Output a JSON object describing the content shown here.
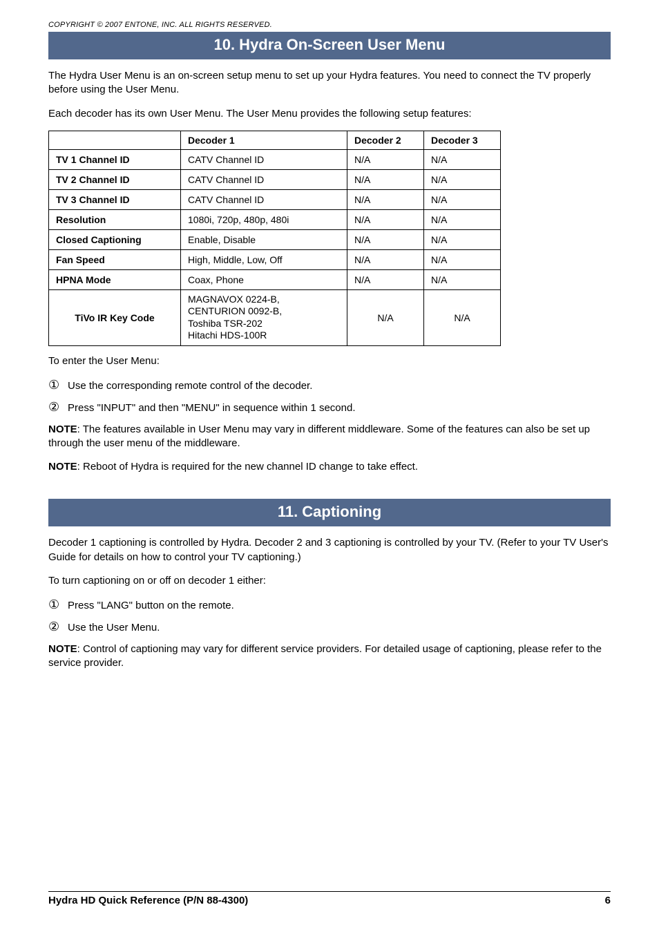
{
  "copyright": "COPYRIGHT © 2007 ENTONE, INC. ALL RIGHTS RESERVED.",
  "section10": {
    "title": "10. Hydra On-Screen User Menu",
    "intro1": "The Hydra User Menu is an on-screen setup menu to set up your Hydra features. You need to connect the TV properly before using the User Menu.",
    "intro2": "Each decoder has its own User Menu. The User Menu provides the following setup features:",
    "table": {
      "headers": {
        "blank": "",
        "d1": "Decoder 1",
        "d2": "Decoder 2",
        "d3": "Decoder 3"
      },
      "rows": [
        {
          "label": "TV 1 Channel ID",
          "d1": "CATV Channel ID",
          "d2": "N/A",
          "d3": "N/A"
        },
        {
          "label": "TV 2 Channel ID",
          "d1": "CATV Channel ID",
          "d2": "N/A",
          "d3": "N/A"
        },
        {
          "label": "TV 3 Channel ID",
          "d1": "CATV Channel ID",
          "d2": "N/A",
          "d3": "N/A"
        },
        {
          "label": "Resolution",
          "d1": "1080i, 720p, 480p, 480i",
          "d2": "N/A",
          "d3": "N/A"
        },
        {
          "label": "Closed Captioning",
          "d1": "Enable, Disable",
          "d2": "N/A",
          "d3": "N/A"
        },
        {
          "label": "Fan Speed",
          "d1": "High, Middle, Low, Off",
          "d2": "N/A",
          "d3": "N/A"
        },
        {
          "label": "HPNA Mode",
          "d1": "Coax, Phone",
          "d2": "N/A",
          "d3": "N/A"
        },
        {
          "label": "TiVo IR Key Code",
          "d1": "MAGNAVOX 0224-B,\nCENTURION 0092-B,\nToshiba TSR-202\nHitachi HDS-100R",
          "d2": "N/A",
          "d3": "N/A"
        }
      ]
    },
    "enter_intro": "To enter the User Menu:",
    "steps": {
      "s1_num": "①",
      "s1_text": "Use the corresponding remote control of the decoder.",
      "s2_num": "②",
      "s2_text": "Press \"INPUT\" and then \"MENU\" in sequence within 1 second."
    },
    "note1_label": "NOTE",
    "note1_text": ": The features available in User Menu may vary in different middleware. Some of the features can also be set up through the user menu of the middleware.",
    "note2_label": "NOTE",
    "note2_text": ": Reboot of Hydra is required for the new channel ID change to take effect."
  },
  "section11": {
    "title": "11. Captioning",
    "intro1": "Decoder 1 captioning is controlled by Hydra. Decoder 2 and 3 captioning is controlled by your TV. (Refer to your TV User's Guide for details on how to control your TV captioning.)",
    "intro2": "To turn captioning on or off on decoder 1 either:",
    "steps": {
      "s1_num": "①",
      "s1_text": "Press \"LANG\" button on the remote.",
      "s2_num": "②",
      "s2_text": "Use the User Menu."
    },
    "note_label": "NOTE",
    "note_text": ": Control of captioning may vary for different service providers. For detailed usage of captioning, please refer to the service provider."
  },
  "footer": {
    "left": "Hydra HD Quick Reference (P/N 88-4300)",
    "right": "6"
  }
}
